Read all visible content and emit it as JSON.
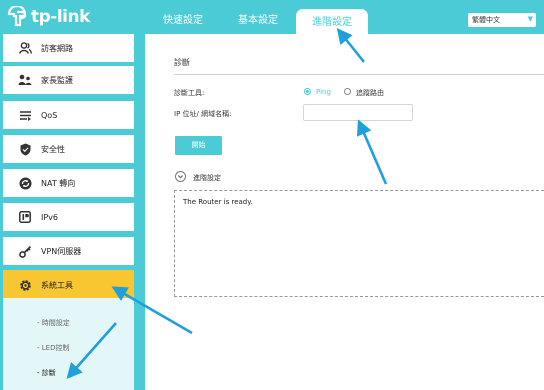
{
  "header": {
    "logo_text": "tp-link",
    "tabs": [
      {
        "label": "快速設定"
      },
      {
        "label": "基本設定"
      },
      {
        "label": "進階設定"
      }
    ],
    "language": {
      "selected": "繁體中文"
    }
  },
  "sidebar": {
    "items": [
      {
        "label": "訪客網路",
        "icon": "users-icon"
      },
      {
        "label": "家長監護",
        "icon": "family-icon"
      },
      {
        "label": "QoS",
        "icon": "qos-icon"
      },
      {
        "label": "安全性",
        "icon": "shield-icon"
      },
      {
        "label": "NAT 轉向",
        "icon": "nat-icon"
      },
      {
        "label": "IPv6",
        "icon": "ipv6-icon"
      },
      {
        "label": "VPN伺服器",
        "icon": "vpn-key-icon"
      },
      {
        "label": "系統工具",
        "icon": "gear-icon"
      }
    ],
    "submenu": [
      {
        "label": "- 時間設定"
      },
      {
        "label": "- LED控制"
      },
      {
        "label": "- 診斷"
      }
    ]
  },
  "main": {
    "section_title": "診斷",
    "tool_label": "診斷工具:",
    "tool_options": [
      {
        "label": "Ping",
        "selected": true
      },
      {
        "label": "追蹤路由",
        "selected": false
      }
    ],
    "ip_label": "IP 位址/ 網域名稱:",
    "ip_value": "",
    "start_button": "開始",
    "advanced_label": "進階設定",
    "result_text": "The Router is ready."
  },
  "colors": {
    "brand": "#4acbd6",
    "active_menu": "#f8c630",
    "annotation_arrow": "#1ea0dc"
  }
}
